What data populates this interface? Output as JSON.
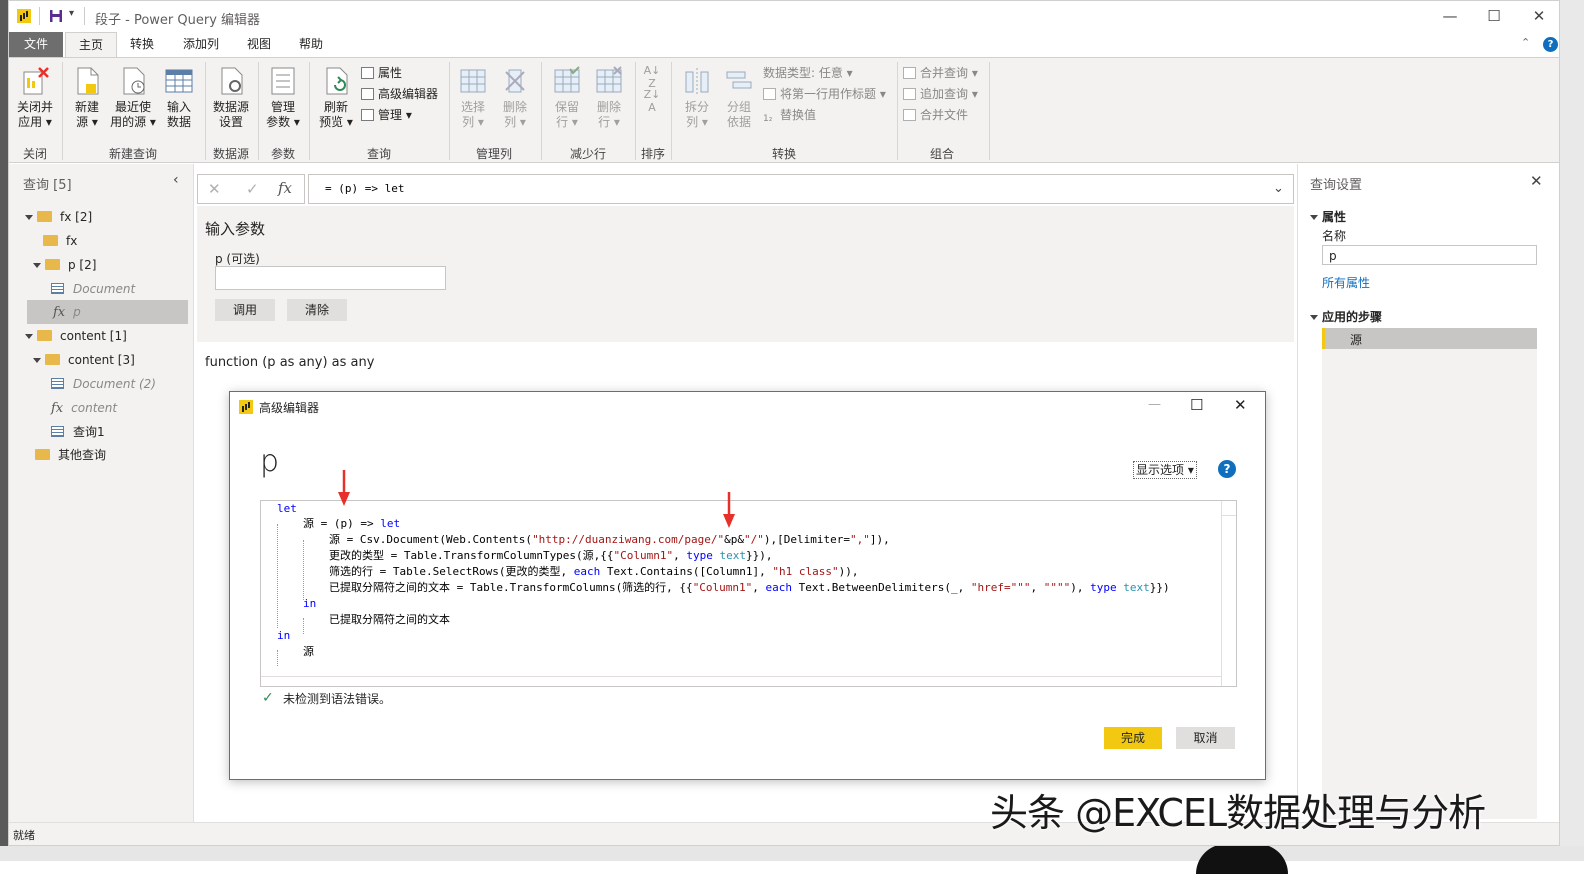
{
  "window": {
    "title": "段子 - Power Query 编辑器"
  },
  "tabs": [
    "文件",
    "主页",
    "转换",
    "添加列",
    "视图",
    "帮助"
  ],
  "ribbon": {
    "close_apply": [
      "关闭并",
      "应用 ▾"
    ],
    "new_source": [
      "新建",
      "源 ▾"
    ],
    "recent_sources": [
      "最近使",
      "用的源 ▾"
    ],
    "enter_data": [
      "输入",
      "数据"
    ],
    "datasource_settings": [
      "数据源",
      "设置"
    ],
    "manage_params": [
      "管理",
      "参数 ▾"
    ],
    "refresh_preview": [
      "刷新",
      "预览 ▾"
    ],
    "properties": "属性",
    "advanced_editor": "高级编辑器",
    "manage": "管理 ▾",
    "choose_columns": [
      "选择",
      "列 ▾"
    ],
    "remove_columns": [
      "删除",
      "列 ▾"
    ],
    "keep_rows": [
      "保留",
      "行 ▾"
    ],
    "remove_rows": [
      "删除",
      "行 ▾"
    ],
    "split_column": [
      "拆分",
      "列 ▾"
    ],
    "group_by": [
      "分组",
      "依据"
    ],
    "data_type": "数据类型: 任意 ▾",
    "first_row_headers": "将第一行用作标题 ▾",
    "replace_values": "替换值",
    "merge_queries": "合并查询 ▾",
    "append_queries": "追加查询 ▾",
    "combine_files": "合并文件",
    "groups": {
      "close": "关闭",
      "new_query": "新建查询",
      "data_source": "数据源",
      "params": "参数",
      "query": "查询",
      "manage_columns": "管理列",
      "reduce_rows": "减少行",
      "sort": "排序",
      "transform": "转换",
      "combine": "组合"
    }
  },
  "queries_pane": {
    "title": "查询 [5]",
    "items": [
      {
        "label": "fx [2]",
        "kind": "folder"
      },
      {
        "label": "fx",
        "kind": "folder"
      },
      {
        "label": "p [2]",
        "kind": "folder"
      },
      {
        "label": "Document",
        "kind": "table"
      },
      {
        "label": "p",
        "kind": "function"
      },
      {
        "label": "content [1]",
        "kind": "folder"
      },
      {
        "label": "content [3]",
        "kind": "folder"
      },
      {
        "label": "Document (2)",
        "kind": "table"
      },
      {
        "label": "content",
        "kind": "function"
      },
      {
        "label": "查询1",
        "kind": "table"
      },
      {
        "label": "其他查询",
        "kind": "folder"
      }
    ]
  },
  "formula_bar": {
    "text": "= (p) => let"
  },
  "center": {
    "enter_params_title": "输入参数",
    "param_label": "p (可选)",
    "invoke_label": "调用",
    "clear_label": "清除",
    "function_signature": "function (p as any) as any"
  },
  "settings_pane": {
    "title": "查询设置",
    "properties_label": "属性",
    "name_label": "名称",
    "name_value": "p",
    "all_properties": "所有属性",
    "applied_steps_label": "应用的步骤",
    "steps": [
      "源"
    ]
  },
  "status": {
    "text": "就绪"
  },
  "dialog": {
    "title": "高级编辑器",
    "query_name": "p",
    "display_options": "显示选项 ▾",
    "help": "?",
    "code_lines": [
      "let",
      "    源 = (p) => let",
      "        源 = Csv.Document(Web.Contents(\"http://duanziwang.com/page/\"&p&\"/\"),[Delimiter=\",\"]),",
      "        更改的类型 = Table.TransformColumnTypes(源,{{\"Column1\", type text}}),",
      "        筛选的行 = Table.SelectRows(更改的类型, each Text.Contains([Column1], \"h1 class\")),",
      "        已提取分隔符之间的文本 = Table.TransformColumns(筛选的行, {{\"Column1\", each Text.BetweenDelimiters(_, \"href=\"\"\", \"\"\"\"), type text}})",
      "    in",
      "        已提取分隔符之间的文本",
      "in",
      "    源"
    ],
    "syntax_status": "未检测到语法错误。",
    "done_label": "完成",
    "cancel_label": "取消"
  },
  "watermark": "头条 @EXCEL数据处理与分析",
  "colors": {
    "accent_yellow": "#f2c811",
    "dialog_border": "#2b7bd4",
    "ribbon_bg": "#f3f2f1",
    "link_blue": "#106ebe",
    "arrow_red": "#e8302a"
  }
}
